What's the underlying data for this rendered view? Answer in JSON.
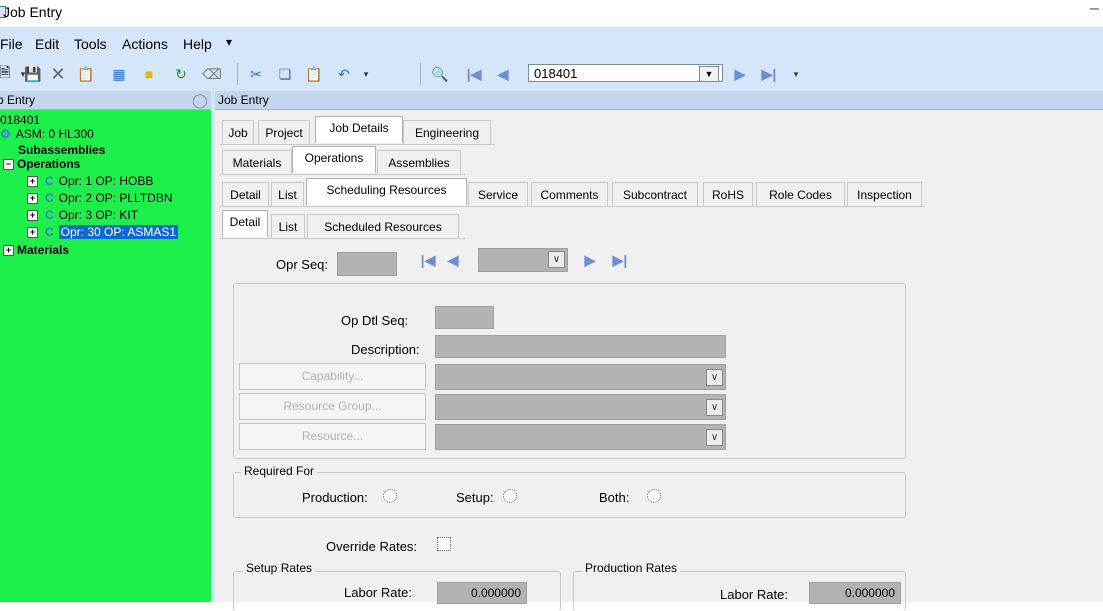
{
  "window": {
    "title": "Job Entry"
  },
  "menu": {
    "items": [
      "File",
      "Edit",
      "Tools",
      "Actions",
      "Help"
    ]
  },
  "toolbar": {
    "record_value": "018401"
  },
  "tree": {
    "header": "b Entry",
    "root": "018401",
    "assembly": "ASM: 0 HL300",
    "subassemblies": "Subassemblies",
    "operations": "Operations",
    "ops": [
      "Opr: 1 OP: HOBB",
      "Opr: 2 OP: PLLTDBN",
      "Opr: 3 OP: KIT",
      "Opr: 30 OP: ASMAS1"
    ],
    "materials": "Materials"
  },
  "main": {
    "header": "Job Entry",
    "tabs_l1": [
      "Job",
      "Project",
      "Job Details",
      "Engineering"
    ],
    "tabs_l2": [
      "Materials",
      "Operations",
      "Assemblies"
    ],
    "tabs_l3": [
      "Detail",
      "List",
      "Scheduling Resources",
      "Service",
      "Comments",
      "Subcontract",
      "RoHS",
      "Role Codes",
      "Inspection"
    ],
    "tabs_l4": [
      "Detail",
      "List",
      "Scheduled Resources"
    ]
  },
  "form": {
    "opr_seq_label": "Opr Seq:",
    "op_dtl_seq_label": "Op Dtl Seq:",
    "description_label": "Description:",
    "capability_button": "Capability...",
    "resource_group_button": "Resource Group...",
    "resource_button": "Resource...",
    "required_for": "Required For",
    "production_label": "Production:",
    "setup_label": "Setup:",
    "both_label": "Both:",
    "override_rates_label": "Override Rates:",
    "setup_rates": "Setup Rates",
    "production_rates": "Production Rates",
    "labor_rate_label": "Labor Rate:",
    "setup_labor_rate": "0.000000",
    "production_labor_rate": "0.000000"
  },
  "colors": {
    "tree_bg": "#1ef04b",
    "selection": "#0a68d8",
    "toolbar_bg": "#d5e5fa"
  }
}
